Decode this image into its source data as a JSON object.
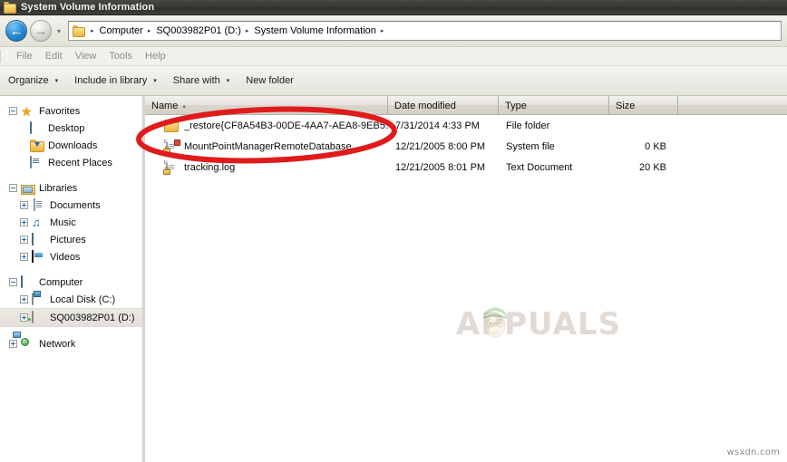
{
  "window": {
    "title": "System Volume Information",
    "icon": "folder-icon"
  },
  "navbar": {
    "back_label": "←",
    "forward_label": "→",
    "history_label": "▾",
    "breadcrumb_icon": "folder-icon",
    "breadcrumbs": [
      {
        "label": "Computer"
      },
      {
        "label": "SQ003982P01 (D:)"
      },
      {
        "label": "System Volume Information"
      }
    ],
    "separator": "▸"
  },
  "menubar": {
    "items": [
      {
        "label": "File"
      },
      {
        "label": "Edit"
      },
      {
        "label": "View"
      },
      {
        "label": "Tools"
      },
      {
        "label": "Help"
      }
    ]
  },
  "toolbar": {
    "buttons": [
      {
        "label": "Organize",
        "caret": "▾"
      },
      {
        "label": "Include in library",
        "caret": "▾"
      },
      {
        "label": "Share with",
        "caret": "▾"
      },
      {
        "label": "New folder",
        "caret": ""
      }
    ]
  },
  "sidebar": {
    "groups": [
      {
        "header": {
          "label": "Favorites",
          "icon": "star-icon",
          "expander": "minus"
        },
        "items": [
          {
            "label": "Desktop",
            "icon": "desktop-monitor-icon",
            "expander": "none"
          },
          {
            "label": "Downloads",
            "icon": "downloads-folder-icon",
            "expander": "none"
          },
          {
            "label": "Recent Places",
            "icon": "recent-places-icon",
            "expander": "none"
          }
        ]
      },
      {
        "header": {
          "label": "Libraries",
          "icon": "library-folder-icon",
          "expander": "minus"
        },
        "items": [
          {
            "label": "Documents",
            "icon": "document-icon",
            "expander": "plus"
          },
          {
            "label": "Music",
            "icon": "music-note-icon",
            "expander": "plus"
          },
          {
            "label": "Pictures",
            "icon": "picture-icon",
            "expander": "plus"
          },
          {
            "label": "Videos",
            "icon": "video-icon",
            "expander": "plus"
          }
        ]
      },
      {
        "header": {
          "label": "Computer",
          "icon": "computer-icon",
          "expander": "minus"
        },
        "items": [
          {
            "label": "Local Disk (C:)",
            "icon": "system-drive-icon",
            "expander": "plus",
            "selected": false
          },
          {
            "label": "SQ003982P01 (D:)",
            "icon": "drive-icon",
            "expander": "plus",
            "selected": true
          }
        ]
      },
      {
        "header": {
          "label": "Network",
          "icon": "network-icon",
          "expander": "plus"
        },
        "items": []
      }
    ]
  },
  "filelist": {
    "columns": [
      {
        "label": "Name",
        "sort": "▴"
      },
      {
        "label": "Date modified",
        "sort": ""
      },
      {
        "label": "Type",
        "sort": ""
      },
      {
        "label": "Size",
        "sort": ""
      }
    ],
    "rows": [
      {
        "name": "_restore{CF8A54B3-00DE-4AA7-AEA8-9EB5…",
        "date": "7/31/2014 4:33 PM",
        "type": "File folder",
        "size": "",
        "icon": "folder-icon"
      },
      {
        "name": "MountPointManagerRemoteDatabase",
        "date": "12/21/2005 8:00 PM",
        "type": "System file",
        "size": "0 KB",
        "icon": "system-file-icon"
      },
      {
        "name": "tracking.log",
        "date": "12/21/2005 8:01 PM",
        "type": "Text Document",
        "size": "20 KB",
        "icon": "text-file-icon"
      }
    ]
  },
  "watermark": {
    "text": "APPUALS"
  },
  "credit": {
    "text": "wsxdn.com"
  },
  "colors": {
    "annotation": "#e01b1b",
    "titlebar": "#3a3a36",
    "selection": "#e5e3db"
  }
}
